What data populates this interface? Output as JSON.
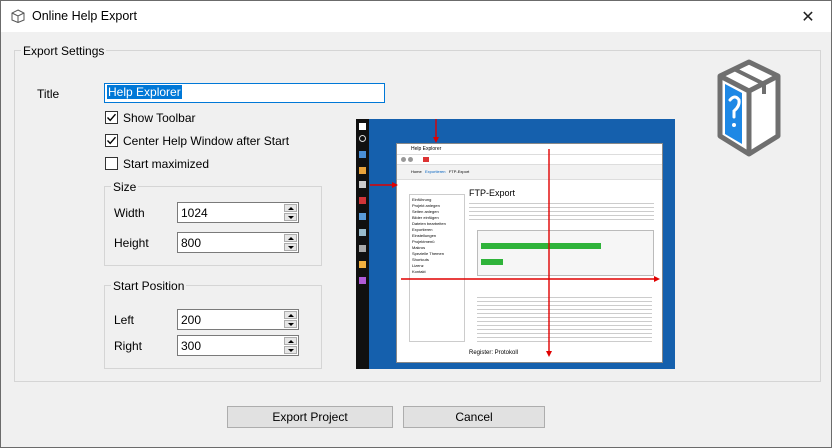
{
  "window": {
    "title": "Online Help Export",
    "close_icon": "close-icon"
  },
  "export_settings": {
    "group_label": "Export Settings",
    "title_label": "Title",
    "title_value": "Help Explorer",
    "show_toolbar": {
      "label": "Show Toolbar",
      "checked": true
    },
    "center_window": {
      "label": "Center Help Window after Start",
      "checked": true
    },
    "start_maximized": {
      "label": "Start maximized",
      "checked": false
    }
  },
  "size": {
    "group_label": "Size",
    "width_label": "Width",
    "width_value": "1024",
    "height_label": "Height",
    "height_value": "800"
  },
  "start_position": {
    "group_label": "Start Position",
    "left_label": "Left",
    "left_value": "200",
    "right_label": "Right",
    "right_value": "300"
  },
  "preview": {
    "window_title": "Help Explorer",
    "breadcrumb": [
      "Home",
      "Exportieren",
      "FTP-Export"
    ],
    "toc": [
      "Einführung",
      "Projekt anlegen",
      "Seiten anlegen",
      "Bilder einfügen",
      "Dateien bearbeiten",
      "Exportieren",
      "Einstellungen",
      "Projektmenü",
      "Makros",
      "Spezielle Themen",
      "Shortcuts",
      "Lizenz",
      "Kontakt"
    ],
    "heading": "FTP-Export",
    "subheading": "Register: Protokoll"
  },
  "buttons": {
    "export": "Export Project",
    "cancel": "Cancel"
  },
  "colors": {
    "accent": "#0078d7",
    "preview_bg": "#1560ad",
    "guide": "#e00000"
  }
}
